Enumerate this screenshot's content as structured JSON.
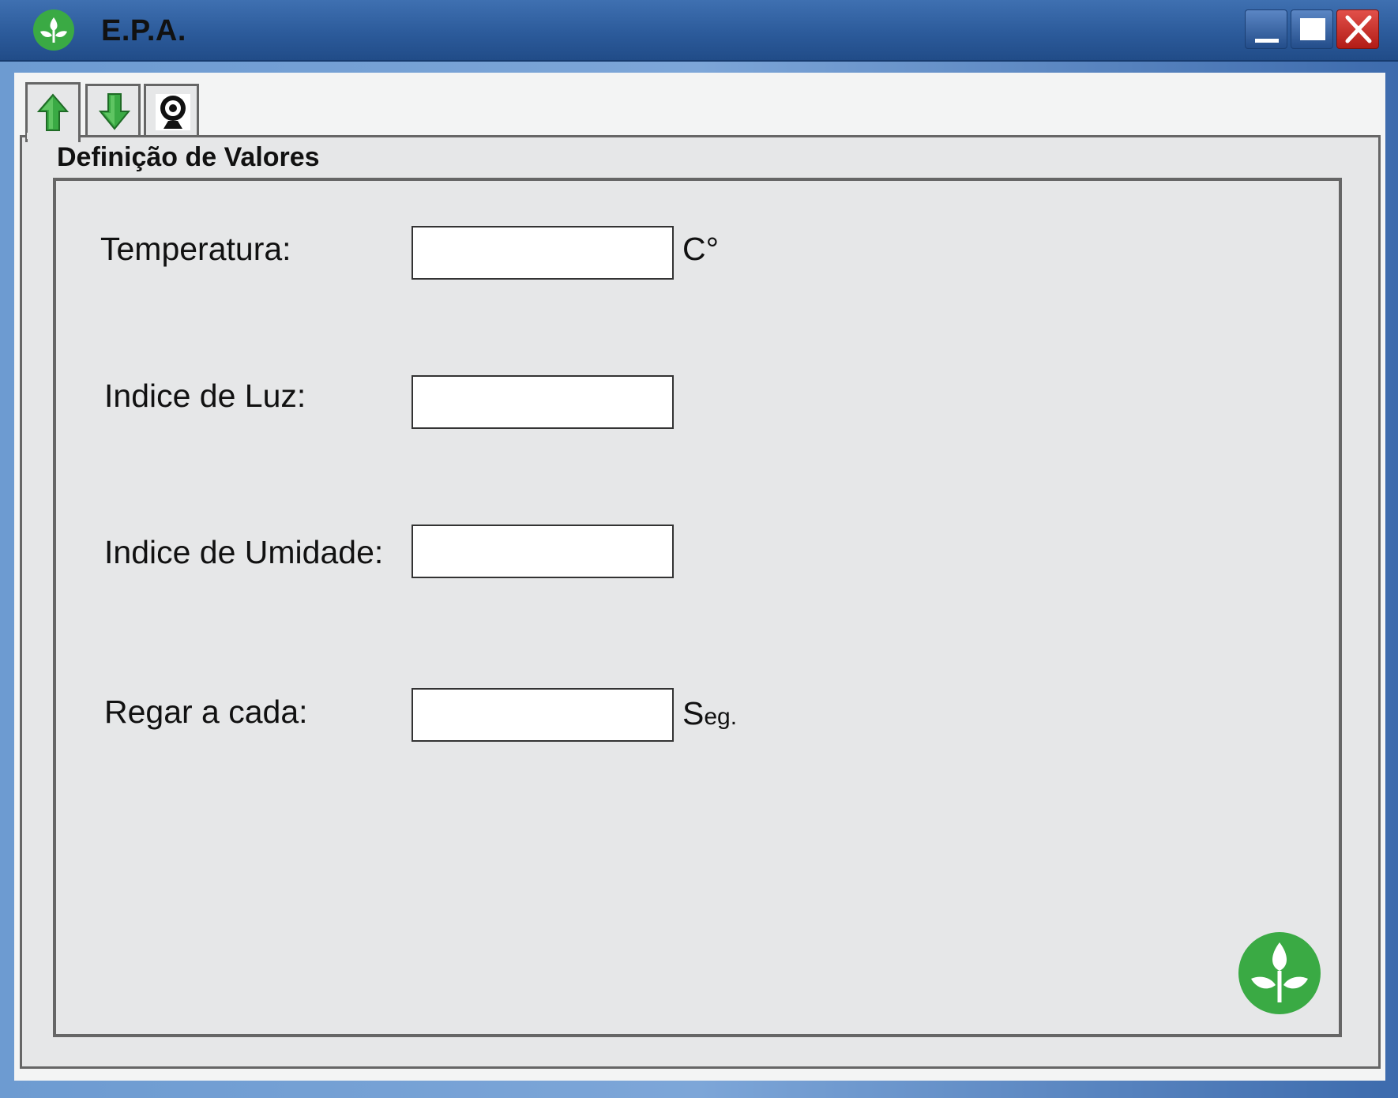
{
  "window": {
    "title": "E.P.A.",
    "accent": "#2c5b9b",
    "brand_green": "#3aaa44"
  },
  "titlebar": {
    "logo": "plant-sprout-icon",
    "buttons": [
      "minimize-icon",
      "maximize-icon",
      "close-icon"
    ]
  },
  "tabs": [
    {
      "icon": "arrow-up-icon",
      "active": true
    },
    {
      "icon": "arrow-down-icon",
      "active": false
    },
    {
      "icon": "webcam-icon",
      "active": false
    }
  ],
  "group": {
    "title": "Definição de Valores"
  },
  "fields": {
    "temperature": {
      "label": "Temperatura:",
      "value": "",
      "unit": "C°"
    },
    "light": {
      "label": "Indice de Luz:",
      "value": ""
    },
    "humidity": {
      "label": "Indice de Umidade:",
      "value": ""
    },
    "watering": {
      "label": "Regar a cada:",
      "value": "",
      "unit_main": "S",
      "unit_rest": "eg."
    }
  },
  "action_button": {
    "icon": "plant-sprout-icon"
  }
}
